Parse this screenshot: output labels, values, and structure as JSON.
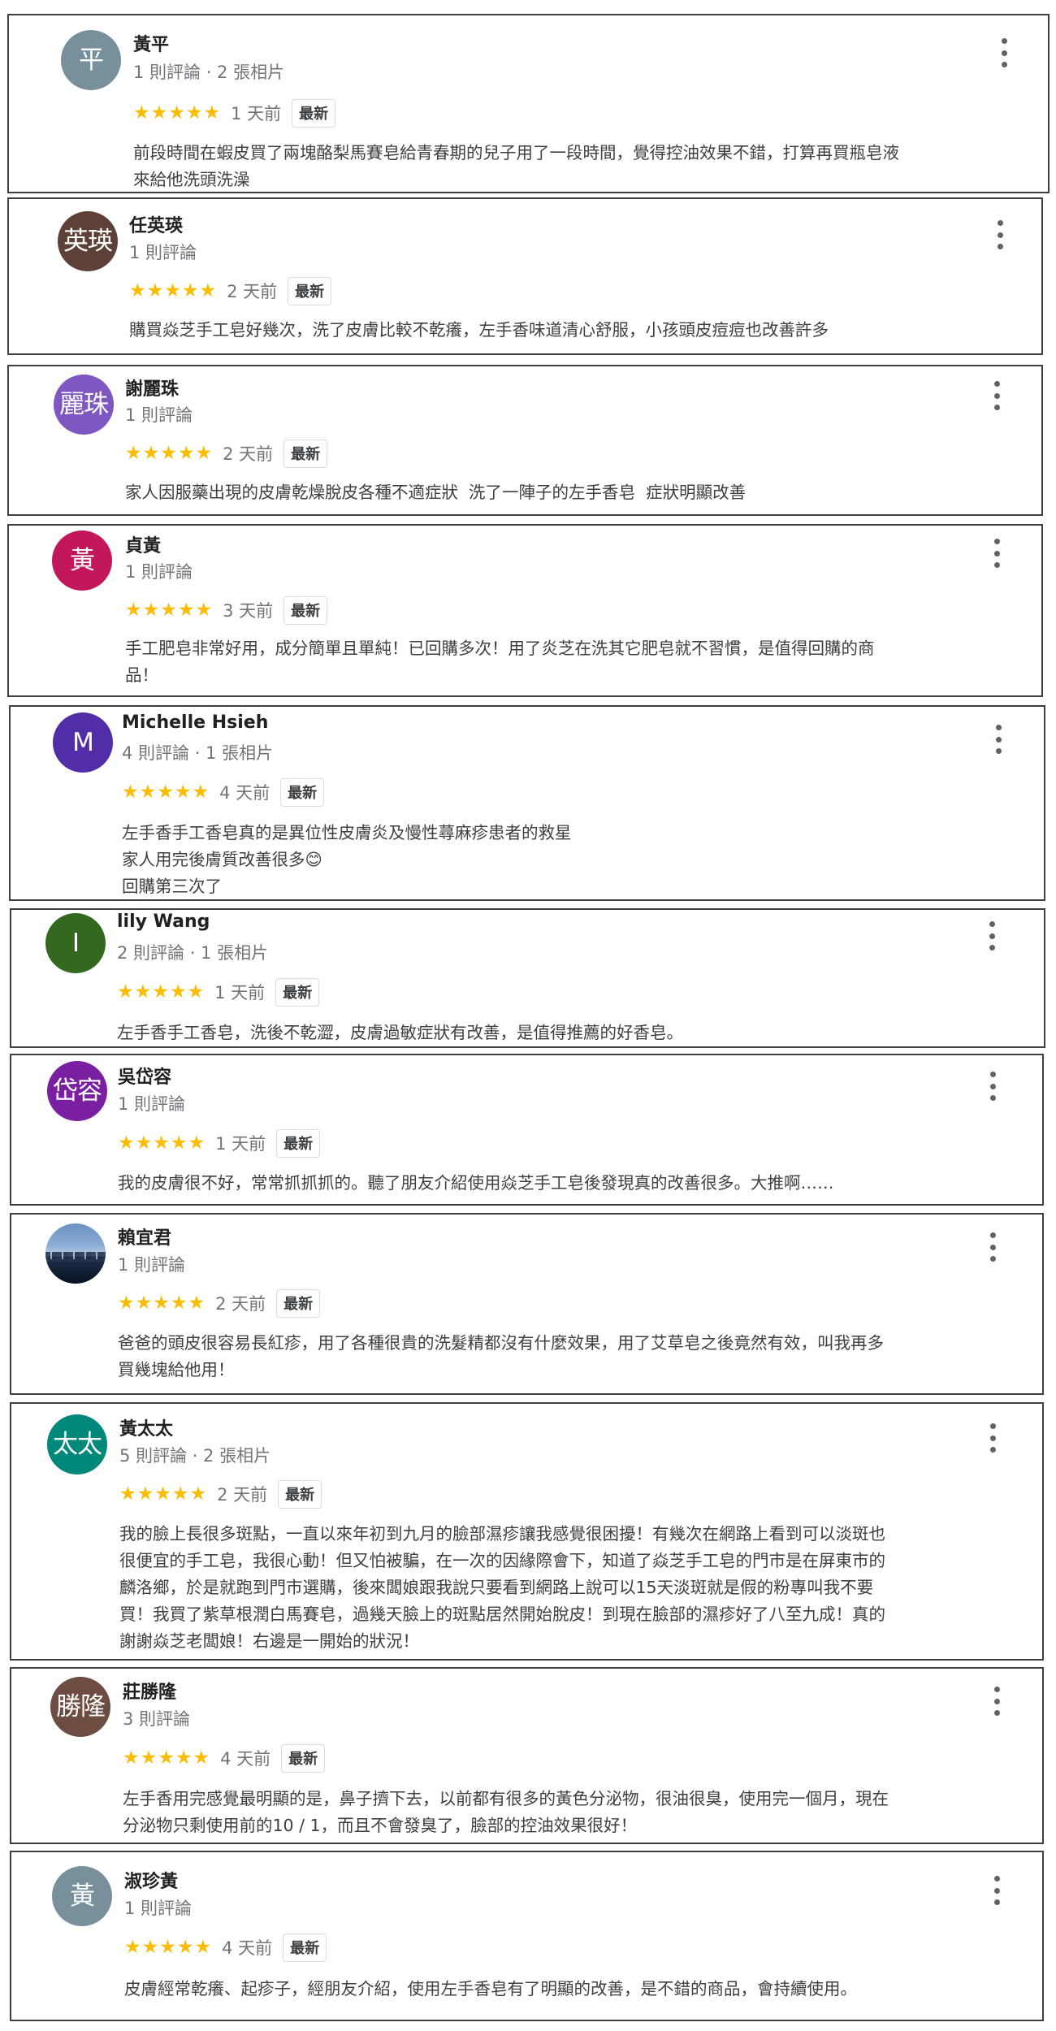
{
  "reviews": [
    {
      "author": "黃平",
      "meta": "1 則評論 · 2 張相片",
      "avatar": {
        "text": "平",
        "color": "#78909c"
      },
      "rating": "★★★★★",
      "date": "1 天前",
      "badge": "最新",
      "text": "前段時間在蝦皮買了兩塊酪梨馬賽皂給青春期的兒子用了一段時間，覺得控油效果不錯，打算再買瓶皂液\n來給他洗頭洗澡"
    },
    {
      "author": "任英瑛",
      "meta": "1 則評論",
      "avatar": {
        "text": "英瑛",
        "color": "#5d4037"
      },
      "rating": "★★★★★",
      "date": "2 天前",
      "badge": "最新",
      "text": "購買焱芝手工皂好幾次，洗了皮膚比較不乾癢，左手香味道清心舒服，小孩頭皮痘痘也改善許多"
    },
    {
      "author": "謝麗珠",
      "meta": "1 則評論",
      "avatar": {
        "text": "麗珠",
        "color": "#7e57c2"
      },
      "rating": "★★★★★",
      "date": "2 天前",
      "badge": "最新",
      "text": "家人因服藥出現的皮膚乾燥脫皮各種不適症狀  洗了一陣子的左手香皂  症狀明顯改善"
    },
    {
      "author": "貞黃",
      "meta": "1 則評論",
      "avatar": {
        "text": "黃",
        "color": "#c2185b"
      },
      "rating": "★★★★★",
      "date": "3 天前",
      "badge": "最新",
      "text": "手工肥皂非常好用，成分簡單且單純！已回購多次！用了炎芝在洗其它肥皂就不習慣，是值得回購的商\n品！"
    },
    {
      "author": "Michelle Hsieh",
      "meta": "4 則評論 · 1 張相片",
      "avatar": {
        "text": "M",
        "color": "#512da8"
      },
      "rating": "★★★★★",
      "date": "4 天前",
      "badge": "最新",
      "text": "左手香手工香皂真的是異位性皮膚炎及慢性蕁麻疹患者的救星\n家人用完後膚質改善很多😊\n回購第三次了"
    },
    {
      "author": "lily Wang",
      "meta": "2 則評論 · 1 張相片",
      "avatar": {
        "text": "I",
        "color": "#33691e"
      },
      "rating": "★★★★★",
      "date": "1 天前",
      "badge": "最新",
      "text": "左手香手工香皂，洗後不乾澀，皮膚過敏症狀有改善，是值得推薦的好香皂。"
    },
    {
      "author": "吳岱容",
      "meta": "1 則評論",
      "avatar": {
        "text": "岱容",
        "color": "#7b1fa2"
      },
      "rating": "★★★★★",
      "date": "1 天前",
      "badge": "最新",
      "text": "我的皮膚很不好，常常抓抓抓的。聽了朋友介紹使用焱芝手工皂後發現真的改善很多。大推啊……"
    },
    {
      "author": "賴宜君",
      "meta": "1 則評論",
      "avatar": {
        "text": "",
        "color": "#26324b",
        "photo": true
      },
      "rating": "★★★★★",
      "date": "2 天前",
      "badge": "最新",
      "text": "爸爸的頭皮很容易長紅疹，用了各種很貴的洗髮精都沒有什麼效果，用了艾草皂之後竟然有效，叫我再多\n買幾塊給他用！"
    },
    {
      "author": "黃太太",
      "meta": "5 則評論 · 2 張相片",
      "avatar": {
        "text": "太太",
        "color": "#00897b"
      },
      "rating": "★★★★★",
      "date": "2 天前",
      "badge": "最新",
      "text": "我的臉上長很多斑點，一直以來年初到九月的臉部濕疹讓我感覺很困擾！有幾次在網路上看到可以淡斑也\n很便宜的手工皂，我很心動！但又怕被騙，在一次的因緣際會下，知道了焱芝手工皂的門市是在屏東市的\n麟洛鄉，於是就跑到門市選購，後來闆娘跟我說只要看到網路上說可以15天淡斑就是假的粉專叫我不要\n買！我買了紫草根潤白馬賽皂，過幾天臉上的斑點居然開始脫皮！到現在臉部的濕疹好了八至九成！真的\n謝謝焱芝老闆娘！右邊是一開始的狀況！"
    },
    {
      "author": "莊勝隆",
      "meta": "3 則評論",
      "avatar": {
        "text": "勝隆",
        "color": "#6d4c41"
      },
      "rating": "★★★★★",
      "date": "4 天前",
      "badge": "最新",
      "text": "左手香用完感覺最明顯的是，鼻子擠下去，以前都有很多的黃色分泌物，很油很臭，使用完一個月，現在\n分泌物只剩使用前的10 / 1，而且不會發臭了，臉部的控油效果很好！"
    },
    {
      "author": "淑珍黃",
      "meta": "1 則評論",
      "avatar": {
        "text": "黃",
        "color": "#78909c"
      },
      "rating": "★★★★★",
      "date": "4 天前",
      "badge": "最新",
      "text": "皮膚經常乾癢、起疹子，經朋友介紹，使用左手香皂有了明顯的改善，是不錯的商品，會持續使用。"
    }
  ]
}
